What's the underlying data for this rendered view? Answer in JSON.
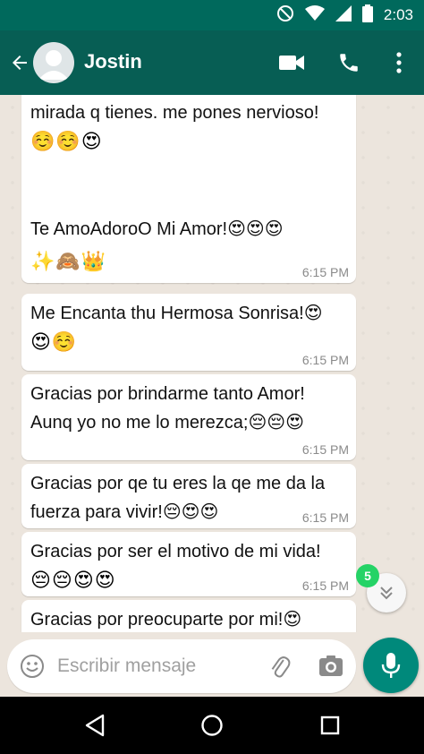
{
  "status_bar": {
    "time": "2:03",
    "icons": [
      "do-not-disturb-icon",
      "wifi-icon",
      "signal-icon",
      "battery-icon"
    ]
  },
  "header": {
    "contact_name": "Jostin",
    "icons": [
      "back-arrow-icon",
      "avatar",
      "video-call-icon",
      "phone-icon",
      "more-vert-icon"
    ]
  },
  "colors": {
    "header": "#075e54",
    "status_bar": "#00695c",
    "accent": "#00897b",
    "badge": "#25d366",
    "bubble": "#ffffff",
    "chat_bg": "#ece5dd"
  },
  "messages": [
    {
      "text": "mirada q tienes. me pones nervioso!",
      "emoji": "☺️☺️😍",
      "time": ""
    },
    {
      "text": "Te AmoAdoroO Mi Amor!😍😍😍",
      "emoji": "✨🙈👑",
      "time": "6:15 PM"
    },
    {
      "text": "Me Encanta thu Hermosa Sonrisa!😍",
      "emoji": "😍☺️",
      "time": "6:15 PM"
    },
    {
      "text": "Gracias por brindarme tanto Amor!\nAunq yo no me lo merezca;😔😔😍",
      "emoji": "",
      "time": "6:15 PM"
    },
    {
      "text": "Gracias por qe tu eres la qe me da la\nfuerza para vivir!😔😍😍",
      "emoji": "",
      "time": "6:15 PM"
    },
    {
      "text": "Gracias por ser el motivo de mi vida!",
      "emoji": "😔😔😍😍",
      "time": "6:15 PM"
    },
    {
      "text": "Gracias por preocuparte por mi!😍",
      "emoji": "",
      "time": ""
    }
  ],
  "scroll_down": {
    "unread_count": "5"
  },
  "composer": {
    "placeholder": "Escribir mensaje"
  },
  "nav": [
    "back-triangle-icon",
    "home-circle-icon",
    "recents-square-icon"
  ]
}
